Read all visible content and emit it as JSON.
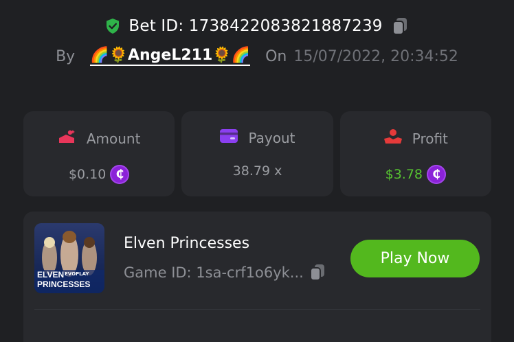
{
  "bet": {
    "label": "Bet ID: 1738422083821887239"
  },
  "author": {
    "by_label": "By",
    "username": "🌈🌻AngeL211🌻🌈",
    "on_label": "On",
    "datetime": "15/07/2022, 20:34:52"
  },
  "stats": [
    {
      "label": "Amount",
      "value": "$0.10",
      "icon": "coins-hand-icon"
    },
    {
      "label": "Payout",
      "value": "38.79 x",
      "icon": "wallet-card-icon"
    },
    {
      "label": "Profit",
      "value": "$3.78",
      "icon": "profit-hand-icon"
    }
  ],
  "currency_symbol": "₵",
  "game": {
    "name": "Elven Princesses",
    "id_text": "Game ID: 1sa-crf1o6yk...",
    "thumb_brand": "EVOPLAY",
    "thumb_title_1": "ELVEN",
    "thumb_title_2": "PRINCESSES",
    "play_label": "Play Now"
  },
  "colors": {
    "background": "#1f2023",
    "card": "#28292d",
    "accent_green": "#53b81e",
    "profit_green": "#57c431",
    "coin_purple": "#8b22d8",
    "shield_green": "#2fb34a"
  }
}
